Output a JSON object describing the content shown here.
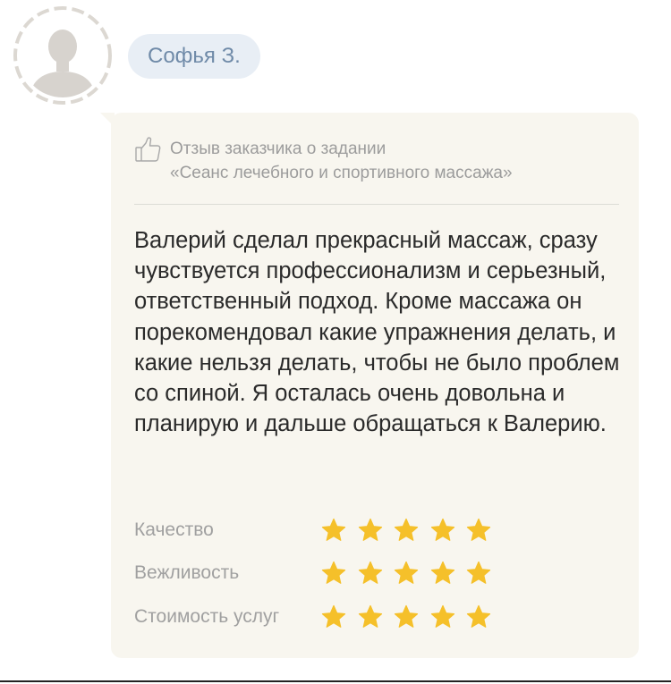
{
  "author": {
    "name": "Софья З."
  },
  "review": {
    "header_line1": "Отзыв заказчика о задании",
    "header_line2": "«Сеанс лечебного и спортивного массажа»",
    "text": "Валерий сделал прекрасный массаж, сразу чувствуется профессионализм и серьезный, ответственный подход. Кроме массажа он порекомендовал какие упражнения делать, и какие нельзя делать, чтобы не было проблем со спиной. Я осталась очень довольна и планирую и дальше обращаться к Валерию.",
    "ratings": [
      {
        "label": "Качество",
        "stars": 5,
        "max": 5
      },
      {
        "label": "Вежливость",
        "stars": 5,
        "max": 5
      },
      {
        "label": "Стоимость услуг",
        "stars": 5,
        "max": 5
      }
    ]
  },
  "icons": {
    "avatar": "user-silhouette-icon",
    "thumb": "thumbs-up-icon",
    "star": "star-icon"
  },
  "colors": {
    "star": "#f5c02a",
    "chip_bg": "#e8eef5",
    "chip_text": "#6f8aa8",
    "bubble_bg": "#f8f6ef",
    "avatar_fill": "#d7d3ce"
  }
}
